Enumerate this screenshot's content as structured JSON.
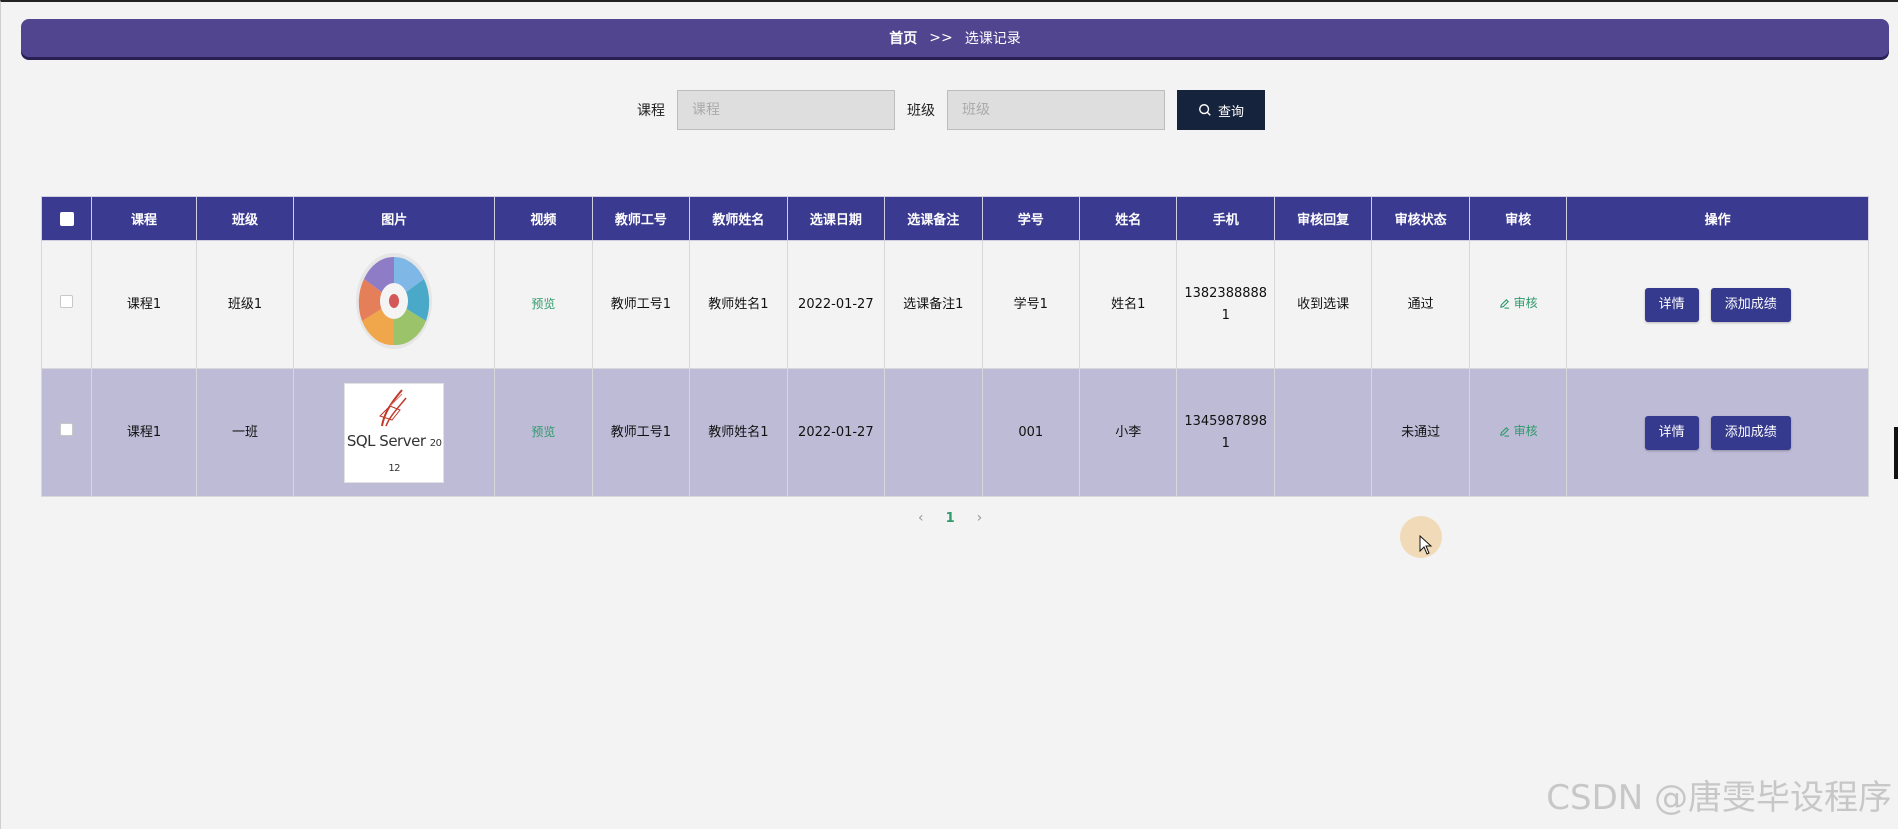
{
  "breadcrumb": {
    "home": "首页",
    "separator": ">>",
    "current": "选课记录"
  },
  "search": {
    "course_label": "课程",
    "course_placeholder": "课程",
    "class_label": "班级",
    "class_placeholder": "班级",
    "button_label": "查询"
  },
  "table": {
    "headers": [
      "课程",
      "班级",
      "图片",
      "视频",
      "教师工号",
      "教师姓名",
      "选课日期",
      "选课备注",
      "学号",
      "姓名",
      "手机",
      "审核回复",
      "审核状态",
      "审核",
      "操作"
    ],
    "rows": [
      {
        "course": "课程1",
        "class": "班级1",
        "image": "course-wheel-image",
        "video": "预览",
        "teacher_id": "教师工号1",
        "teacher_name": "教师姓名1",
        "date": "2022-01-27",
        "remark": "选课备注1",
        "student_id": "学号1",
        "name": "姓名1",
        "phone": "13823888881",
        "reply": "收到选课",
        "status": "通过",
        "audit": "审核"
      },
      {
        "course": "课程1",
        "class": "一班",
        "image": "sql-server-image",
        "video": "预览",
        "teacher_id": "教师工号1",
        "teacher_name": "教师姓名1",
        "date": "2022-01-27",
        "remark": "",
        "student_id": "001",
        "name": "小李",
        "phone": "13459878981",
        "reply": "",
        "status": "未通过",
        "audit": "审核"
      }
    ],
    "actions": {
      "detail": "详情",
      "add_score": "添加成绩"
    },
    "sql_logo_text": "SQL Server",
    "sql_logo_year": "2012"
  },
  "pagination": {
    "prev": "‹",
    "current": "1",
    "next": "›"
  },
  "colors": {
    "header": "#3b3a91",
    "breadcrumb": "#524590",
    "button": "#353a8f",
    "link": "#2f9a6b",
    "row_alt": "#bebbd6"
  },
  "watermark": "CSDN @唐雯毕设程序"
}
